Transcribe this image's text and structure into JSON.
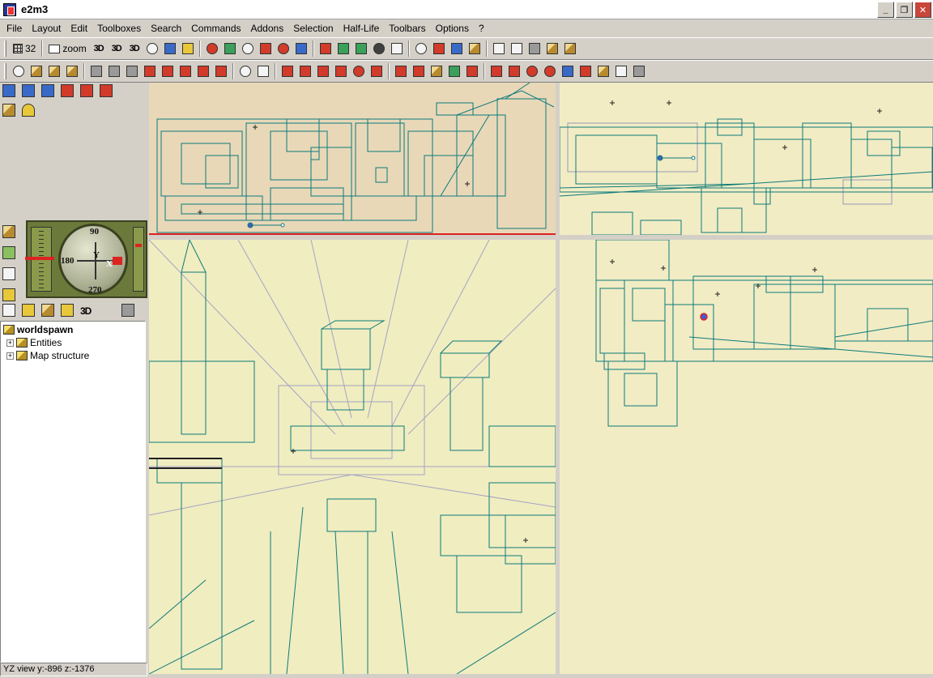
{
  "window": {
    "title": "e2m3"
  },
  "menu": [
    "File",
    "Layout",
    "Edit",
    "Toolboxes",
    "Search",
    "Commands",
    "Addons",
    "Selection",
    "Half-Life",
    "Toolbars",
    "Options",
    "?"
  ],
  "toolbar": {
    "grid_value": "32",
    "zoom_label": "zoom",
    "view_3d_label": "3D"
  },
  "compass": {
    "north": "90",
    "west": "180",
    "south": "270",
    "axis_y": "Y",
    "axis_x": "X"
  },
  "tree_toolbar": {
    "label_3d": "3D"
  },
  "tree": {
    "root": "worldspawn",
    "children": [
      "Entities",
      "Map structure"
    ]
  },
  "status": {
    "text": "YZ view y:-896 z:-1376"
  },
  "colors": {
    "accent_teal": "#0d7a7a",
    "grid_red": "#d22222",
    "viewport_bg": "#f1ecc4",
    "top_view_bg": "#e8d8b8"
  }
}
